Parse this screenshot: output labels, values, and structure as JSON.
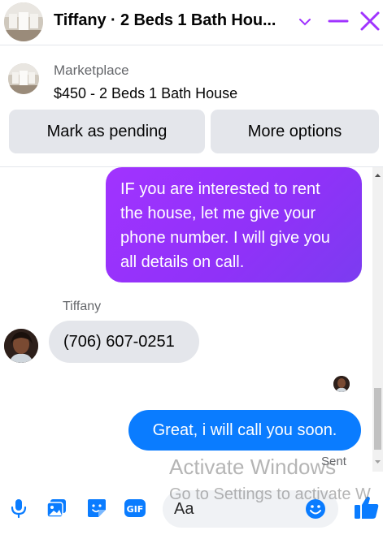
{
  "header": {
    "title": "Tiffany · 2 Beds 1 Bath Hou...",
    "avatar_icon": "house-thumbnail-icon",
    "chevron_icon": "chevron-down-icon",
    "minimize_icon": "minimize-icon",
    "close_icon": "close-icon",
    "accent_color": "#a033ff"
  },
  "marketplace": {
    "label": "Marketplace",
    "listing": "$450 - 2 Beds 1 Bath House",
    "mark_pending": "Mark as pending",
    "more_options": "More options"
  },
  "messages": [
    {
      "direction": "outgoing",
      "text": "IF you are interested to rent the house, let me give your phone number. I will give you all details on call.",
      "color": "#9b34fb"
    },
    {
      "direction": "incoming",
      "sender": "Tiffany",
      "text": "(706) 607-0251",
      "color": "#e4e6eb"
    },
    {
      "direction": "outgoing",
      "text": "Great, i will call you soon.",
      "color": "#0a7cff",
      "status": "Sent"
    }
  ],
  "composer": {
    "placeholder": "Aa",
    "icons": [
      "microphone-icon",
      "photo-icon",
      "sticker-icon",
      "gif-icon",
      "emoji-icon",
      "thumbs-up-icon"
    ],
    "accent_color": "#0a7cff"
  },
  "watermark": {
    "line1": "Activate Windows",
    "line2": "Go to Settings to activate W"
  }
}
